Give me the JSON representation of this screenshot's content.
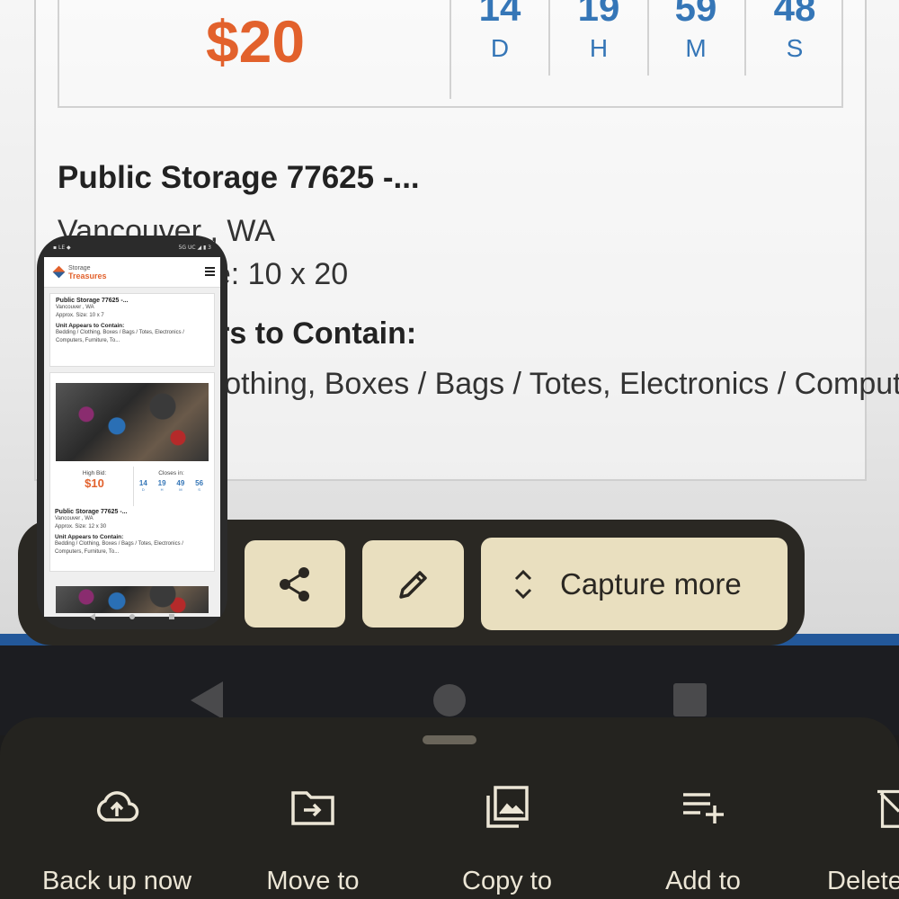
{
  "background_page": {
    "bid_amount": "$20",
    "countdown": [
      {
        "value": "14",
        "unit": "D"
      },
      {
        "value": "19",
        "unit": "H"
      },
      {
        "value": "59",
        "unit": "M"
      },
      {
        "value": "48",
        "unit": "S"
      }
    ],
    "title": "Public Storage 77625 -...",
    "location": "Vancouver , WA",
    "approx_size": "Approx. Size: 10 x 20",
    "contains_heading": "Unit Appears to Contain:",
    "contains_text": "Bedding / Clothing, Boxes / Bags / Totes, Electronics / Computers"
  },
  "thumbnail": {
    "status_left": "▪ LE ◆",
    "status_right": "5G UC ◢ ▮ 3",
    "logo_top": "Storage",
    "logo_bottom": "Treasures",
    "card1": {
      "title": "Public Storage 77625 -...",
      "location": "Vancouver , WA",
      "size": "Approx. Size: 10 x 7",
      "contains_heading": "Unit Appears to Contain:",
      "contains_text": "Bedding / Clothing, Boxes / Bags / Totes, Electronics / Computers, Furniture, To..."
    },
    "bid": {
      "label": "High Bid:",
      "amount": "$10",
      "closes_label": "Closes in:",
      "countdown": [
        {
          "value": "14",
          "unit": "D"
        },
        {
          "value": "19",
          "unit": "H"
        },
        {
          "value": "49",
          "unit": "M"
        },
        {
          "value": "56",
          "unit": "S"
        }
      ]
    },
    "card2": {
      "title": "Public Storage 77625 -...",
      "location": "Vancouver , WA",
      "size": "Approx. Size: 12 x 30",
      "contains_heading": "Unit Appears to Contain:",
      "contains_text": "Bedding / Clothing, Boxes / Bags / Totes, Electronics / Computers, Furniture, To..."
    }
  },
  "toolbar": {
    "share_icon": "share-icon",
    "edit_icon": "pencil-icon",
    "capture_icon": "expand-vertical-icon",
    "capture_label": "Capture more"
  },
  "sheet_actions": [
    {
      "icon": "cloud-upload-icon",
      "label": "Back up now"
    },
    {
      "icon": "move-to-folder-icon",
      "label": "Move to"
    },
    {
      "icon": "copy-to-folder-icon",
      "label": "Copy to"
    },
    {
      "icon": "playlist-add-icon",
      "label": "Add to"
    },
    {
      "icon": "delete-icon",
      "label": "Delete"
    }
  ],
  "colors": {
    "bid_orange": "#e2612c",
    "countdown_blue": "#3576b7",
    "toolbar_button": "#e9dfbf",
    "sheet_bg": "#24231f"
  }
}
